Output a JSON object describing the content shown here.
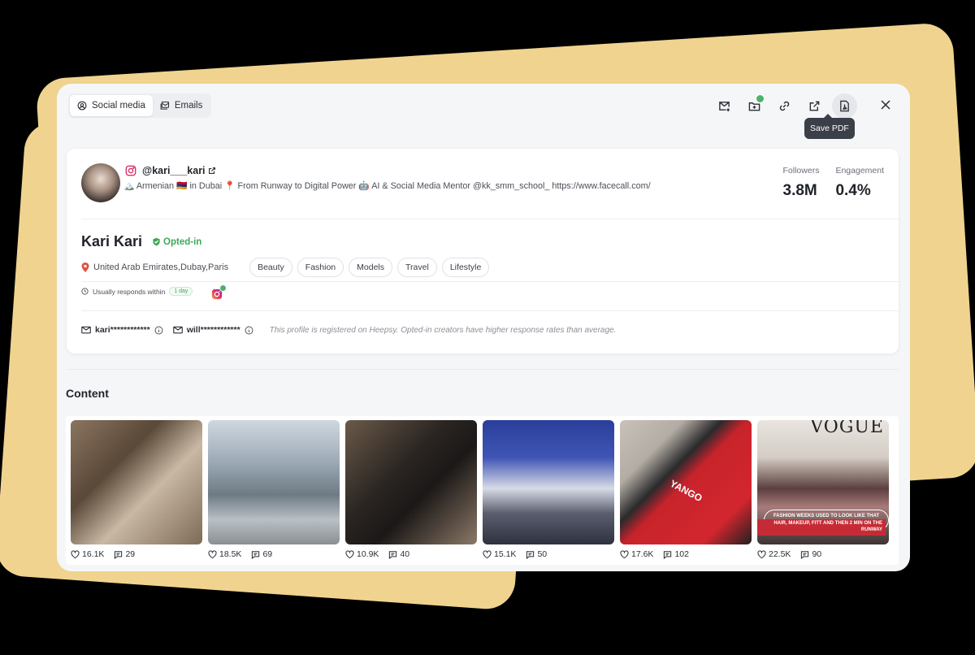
{
  "tabs": [
    {
      "label": "Social media",
      "active": true,
      "icon": "at-sign-icon"
    },
    {
      "label": "Emails",
      "active": false,
      "icon": "mail-stack-icon"
    }
  ],
  "toolbar": {
    "icons": [
      "mail-plus-icon",
      "folder-check-icon",
      "link-icon",
      "external-link-icon",
      "file-pdf-icon",
      "close-icon"
    ],
    "tooltip": "Save PDF"
  },
  "profile": {
    "handle": "@kari___kari",
    "bio": "🏔️ Armenian 🇦🇲 in Dubai 📍 From Runway to Digital Power 🤖 AI & Social Media Mentor @kk_smm_school_ https://www.facecall.com/",
    "name": "Kari Kari",
    "opted_label": "Opted-in",
    "location": "United Arab Emirates,Dubay,Paris",
    "tags": [
      "Beauty",
      "Fashion",
      "Models",
      "Travel",
      "Lifestyle"
    ],
    "responds_label": "Usually responds within",
    "responds_value": "1 day",
    "emails": [
      "kari************",
      "will************"
    ],
    "email_note": "This profile is registered on Heepsy. Opted-in creators have higher response rates than average."
  },
  "stats": {
    "followers_label": "Followers",
    "followers_value": "3.8M",
    "engagement_label": "Engagement",
    "engagement_value": "0.4%"
  },
  "content": {
    "title": "Content",
    "posts": [
      {
        "likes": "16.1K",
        "comments": "29"
      },
      {
        "likes": "18.5K",
        "comments": "69"
      },
      {
        "likes": "10.9K",
        "comments": "40"
      },
      {
        "likes": "15.1K",
        "comments": "50"
      },
      {
        "likes": "17.6K",
        "comments": "102"
      },
      {
        "likes": "22.5K",
        "comments": "90"
      }
    ],
    "post5_text": "YANGO",
    "post6_masthead": "VOGUE",
    "post6_caption1": "FASHION WEEKS USED TO LOOK LIKE THAT FOR ME",
    "post6_caption2": "HAIR, MAKEUP, FITT AND THEN 2 MIN ON THE RUNWAY"
  },
  "colors": {
    "background": "#000000",
    "accent_shape": "#f0d38f",
    "panel": "#f5f6f8",
    "success": "#3ea858",
    "tooltip": "#3b3f47"
  }
}
